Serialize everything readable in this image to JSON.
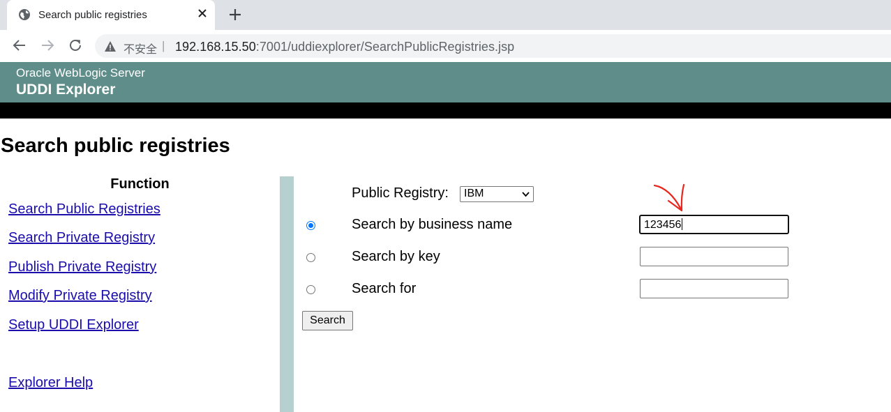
{
  "browser": {
    "tab_title": "Search public registries",
    "address": {
      "security_label": "不安全",
      "separator": "|",
      "host": "192.168.15.50",
      "path": ":7001/uddiexplorer/SearchPublicRegistries.jsp"
    },
    "icons": [
      "globe-icon",
      "close-icon",
      "plus-icon",
      "back-arrow-icon",
      "forward-arrow-icon",
      "reload-icon",
      "warning-icon"
    ]
  },
  "header": {
    "product": "Oracle WebLogic Server",
    "app": "UDDI Explorer",
    "banner_color": "#5f8d8a"
  },
  "page": {
    "title": "Search public registries"
  },
  "sidebar": {
    "heading": "Function",
    "links": [
      "Search Public Registries",
      "Search Private Registry",
      "Publish Private Registry",
      "Modify Private Registry",
      "Setup UDDI Explorer"
    ],
    "help": "Explorer Help"
  },
  "form": {
    "registry_label": "Public Registry:",
    "registry_selected": "IBM",
    "options": [
      {
        "label": "Search by business name",
        "selected": true,
        "value": "123456"
      },
      {
        "label": "Search by key",
        "selected": false,
        "value": ""
      },
      {
        "label": "Search for",
        "selected": false,
        "value": ""
      }
    ],
    "submit_label": "Search",
    "annotation_color": "#e8261c"
  }
}
